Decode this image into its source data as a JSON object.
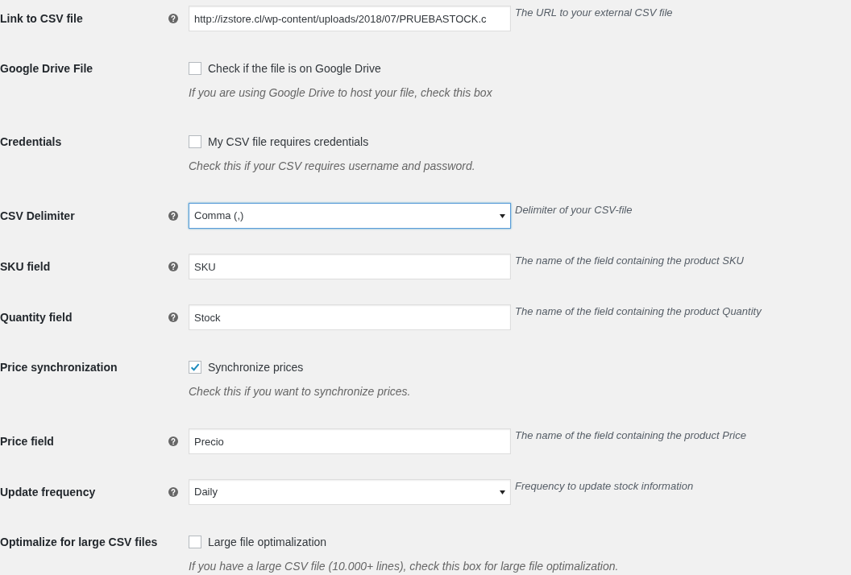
{
  "settings": [
    {
      "kind": "text",
      "label": "Link to CSV file",
      "help": true,
      "value": "http://izstore.cl/wp-content/uploads/2018/07/PRUEBASTOCK.c",
      "focused": false,
      "description": "The URL to your external CSV file"
    },
    {
      "kind": "checkbox",
      "label": "Google Drive File",
      "help": false,
      "checked": false,
      "option": "Check if the file is on Google Drive",
      "description": "If you are using Google Drive to host your file, check this box"
    },
    {
      "kind": "checkbox",
      "label": "Credentials",
      "help": false,
      "checked": false,
      "option": "My CSV file requires credentials",
      "description": "Check this if your CSV requires username and password."
    },
    {
      "kind": "select",
      "label": "CSV Delimiter",
      "help": true,
      "value": "Comma (,)",
      "focused": true,
      "description": "Delimiter of your CSV-file"
    },
    {
      "kind": "text",
      "label": "SKU field",
      "help": true,
      "value": "SKU",
      "focused": false,
      "description": "The name of the field containing the product SKU"
    },
    {
      "kind": "text",
      "label": "Quantity field",
      "help": true,
      "value": "Stock",
      "focused": false,
      "description": "The name of the field containing the product Quantity"
    },
    {
      "kind": "checkbox",
      "label": "Price synchronization",
      "help": false,
      "checked": true,
      "option": "Synchronize prices",
      "description": "Check this if you want to synchronize prices."
    },
    {
      "kind": "text",
      "label": "Price field",
      "help": true,
      "value": "Precio",
      "focused": false,
      "description": "The name of the field containing the product Price"
    },
    {
      "kind": "select",
      "label": "Update frequency",
      "help": true,
      "value": "Daily",
      "focused": false,
      "description": "Frequency to update stock information"
    },
    {
      "kind": "checkbox",
      "label": "Optimalize for large CSV files",
      "help": false,
      "checked": false,
      "option": "Large file optimalization",
      "description": "If you have a large CSV file (10.000+ lines), check this box for large file optimalization."
    }
  ]
}
